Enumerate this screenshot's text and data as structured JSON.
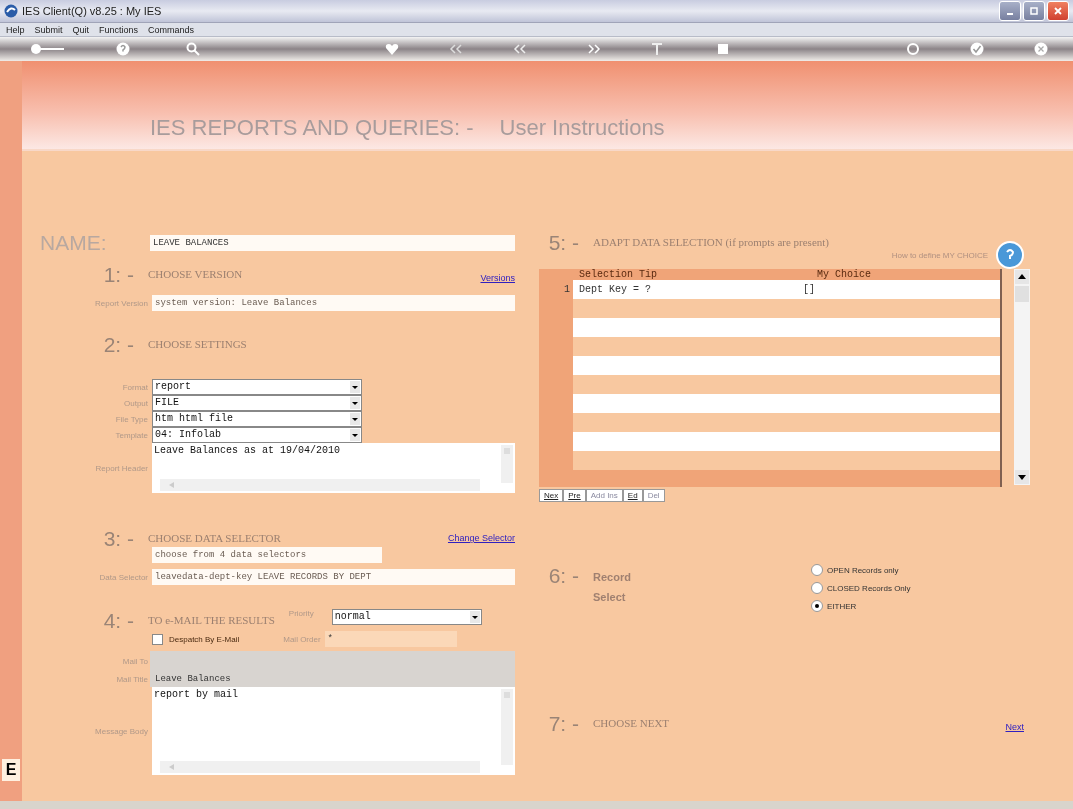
{
  "window": {
    "title": "IES Client(Q) v8.25 : My IES"
  },
  "menu": [
    "Help",
    "Submit",
    "Quit",
    "Functions",
    "Commands"
  ],
  "header": {
    "title": "IES REPORTS AND QUERIES: -",
    "subtitle": "User Instructions"
  },
  "name": {
    "label": "NAME:",
    "value": "LEAVE BALANCES"
  },
  "version": {
    "number": "1: -",
    "title": "CHOOSE VERSION",
    "link": "Versions",
    "field_label": "Report Version",
    "value": "system version: Leave Balances"
  },
  "settings": {
    "number": "2: -",
    "title": "CHOOSE SETTINGS",
    "dropdowns": [
      {
        "label": "Format",
        "value": "report"
      },
      {
        "label": "Output",
        "value": "FILE"
      },
      {
        "label": "File Type",
        "value": "htm html file"
      },
      {
        "label": "Template",
        "value": "04: Infolab"
      }
    ],
    "header_label": "Report Header",
    "header_value": "Leave Balances as at 19/04/2010"
  },
  "selector": {
    "number": "3: -",
    "title": "CHOOSE DATA SELECTOR",
    "link": "Change Selector",
    "hint": "choose from 4 data selectors",
    "field_label": "Data Selector",
    "value": "leavedata-dept-key LEAVE RECORDS BY DEPT"
  },
  "email": {
    "number": "4: -",
    "title": "TO e-MAIL THE RESULTS",
    "priority_label": "Priority",
    "priority": "normal",
    "despatch": {
      "label": "Despatch By E-Mail",
      "checked": false
    },
    "mail_order_label": "Mail Order",
    "mail_order": "*",
    "mail_to_label": "Mail To",
    "mail_title_label": "Mail Title",
    "mail_title": "Leave Balances",
    "body_label": "Message Body",
    "body": "report by mail"
  },
  "adapt": {
    "number": "5: -",
    "title": "ADAPT DATA SELECTION (if prompts are present)",
    "help_link": "How to define MY CHOICE",
    "columns": [
      "Selection Tip",
      "My Choice"
    ],
    "rows": [
      {
        "index": "1",
        "tip": "Dept Key = ?",
        "choice": "[]"
      }
    ],
    "buttons": [
      {
        "label": "Nex",
        "disabled": false
      },
      {
        "label": "Pre",
        "disabled": false
      },
      {
        "label": "Add Ins",
        "disabled": true
      },
      {
        "label": "Ed",
        "disabled": false
      },
      {
        "label": "Del",
        "disabled": true
      }
    ]
  },
  "record_select": {
    "number": "6: -",
    "title": "Record Select",
    "options": [
      {
        "label": "OPEN Records only",
        "selected": false
      },
      {
        "label": "CLOSED Records Only",
        "selected": false
      },
      {
        "label": "EITHER",
        "selected": true
      }
    ]
  },
  "next": {
    "number": "7: -",
    "title": "CHOOSE NEXT",
    "link": "Next"
  },
  "side_tab": "E"
}
